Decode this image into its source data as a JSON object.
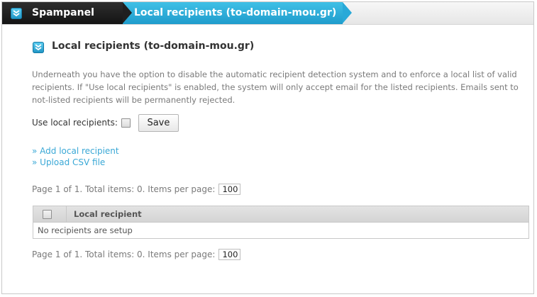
{
  "breadcrumb": {
    "root": "Spampanel",
    "current": "Local recipients (to-domain-mou.gr)"
  },
  "section": {
    "title": "Local recipients (to-domain-mou.gr)",
    "description": "Underneath you have the option to disable the automatic recipient detection system and to enforce a local list of valid recipients. If \"Use local recipients\" is enabled, the system will only accept email for the listed recipients. Emails sent to not-listed recipients will be permanently rejected."
  },
  "settings": {
    "use_local_label": "Use local recipients:",
    "use_local_checked": false,
    "save_label": "Save"
  },
  "links": {
    "add": "» Add local recipient",
    "upload": "» Upload CSV file"
  },
  "pager": {
    "text": "Page 1 of 1. Total items: 0. Items per page:",
    "per_page": "100"
  },
  "table": {
    "columns": [
      "Local recipient"
    ],
    "empty_message": "No recipients are setup"
  },
  "colors": {
    "accent": "#29a9d8",
    "dark": "#1f1f1f",
    "link": "#3aa8d6"
  },
  "icons": {
    "header": "chevron-down-icon"
  }
}
